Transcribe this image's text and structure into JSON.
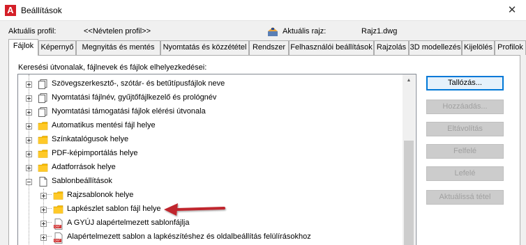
{
  "window": {
    "title": "Beállítások",
    "close_label": "✕"
  },
  "profile": {
    "current_profile_label": "Aktuális profil:",
    "current_profile_value": "<<Névtelen profil>>",
    "current_drawing_label": "Aktuális rajz:",
    "current_drawing_value": "Rajz1.dwg"
  },
  "tabs": [
    {
      "label": "Fájlok",
      "active": true
    },
    {
      "label": "Képernyő"
    },
    {
      "label": "Megnyitás és mentés"
    },
    {
      "label": "Nyomtatás és közzététel"
    },
    {
      "label": "Rendszer"
    },
    {
      "label": "Felhasználói beállítások"
    },
    {
      "label": "Rajzolás"
    },
    {
      "label": "3D modellezés"
    },
    {
      "label": "Kijelölés"
    },
    {
      "label": "Profilok"
    }
  ],
  "files_panel": {
    "caption": "Keresési útvonalak, fájlnevek és fájlok elhelyezkedései:",
    "tree_items": [
      {
        "label": "Szövegszerkesztő-, szótár- és betűtípusfájlok neve",
        "icon": "documents-icon",
        "level": 0
      },
      {
        "label": "Nyomtatási fájlnév, gyűjtőfájlkezelő és prológnév",
        "icon": "documents-icon",
        "level": 0
      },
      {
        "label": "Nyomtatási támogatási fájlok elérési útvonala",
        "icon": "documents-icon",
        "level": 0
      },
      {
        "label": "Automatikus mentési fájl helye",
        "icon": "folder-icon",
        "level": 0
      },
      {
        "label": "Színkatalógusok helye",
        "icon": "folder-icon",
        "level": 0
      },
      {
        "label": "PDF-képimportálás helye",
        "icon": "folder-icon",
        "level": 0
      },
      {
        "label": "Adatforrások helye",
        "icon": "folder-icon",
        "level": 0
      },
      {
        "label": "Sablonbeállítások",
        "icon": "document-icon",
        "level": 0,
        "expanded": true
      },
      {
        "label": "Rajzsablonok helye",
        "icon": "folder-icon",
        "level": 1
      },
      {
        "label": "Lapkészlet sablon fájl helye",
        "icon": "folder-icon",
        "level": 1,
        "highlighted": true
      },
      {
        "label": "A GYÚJ alapértelmezett sablonfájlja",
        "icon": "dwt-file-icon",
        "level": 1
      },
      {
        "label": "Alapértelmezett sablon a lapkészítéshez és oldalbeállítás felülírásokhoz",
        "icon": "dwt-file-icon",
        "level": 1
      }
    ],
    "buttons": [
      {
        "label": "Tallózás...",
        "enabled": true
      },
      {
        "label": "Hozzáadás...",
        "enabled": false
      },
      {
        "label": "Eltávolítás",
        "enabled": false
      },
      {
        "label": "Felfelé",
        "enabled": false
      },
      {
        "label": "Lefelé",
        "enabled": false
      },
      {
        "label": "Aktuálissá tétel",
        "enabled": false
      }
    ]
  },
  "colors": {
    "arrow": "#c0272d",
    "folder": "#f5b800",
    "disabled_text": "#a0a0a0",
    "dwt_red": "#cc1f1f"
  }
}
